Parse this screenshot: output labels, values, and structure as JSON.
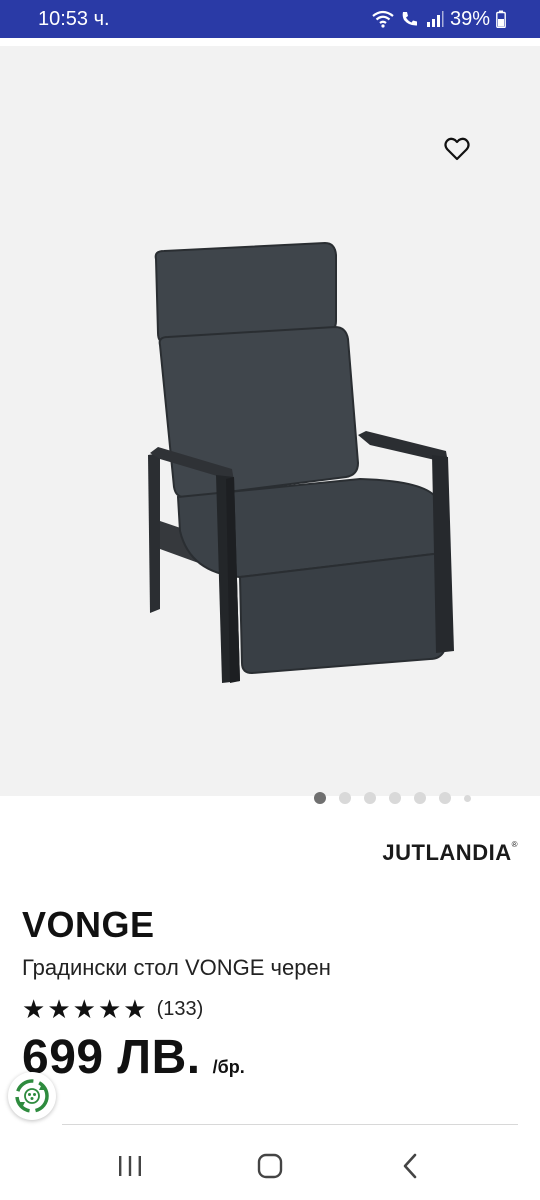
{
  "status_bar": {
    "time": "10:53 ч.",
    "battery": "39%"
  },
  "gallery": {
    "dots": [
      true,
      false,
      false,
      false,
      false,
      false,
      false
    ]
  },
  "brand": {
    "name": "JUTLANDIA",
    "mark": "®"
  },
  "product": {
    "title": "VONGE",
    "subtitle": "Градински стол VONGE черен",
    "rating": 5,
    "review_count": "(133)",
    "price": "699 ЛВ.",
    "price_unit": "/бр."
  },
  "colors": {
    "status_bar": "#2a3aa6",
    "gallery_bg": "#f2f2f2",
    "eco_green": "#2e8b3e"
  },
  "icons": {
    "favorite": "heart-icon",
    "eco": "recycle-icon",
    "nav_recent": "recent-apps-icon",
    "nav_home": "home-icon",
    "nav_back": "back-icon"
  }
}
